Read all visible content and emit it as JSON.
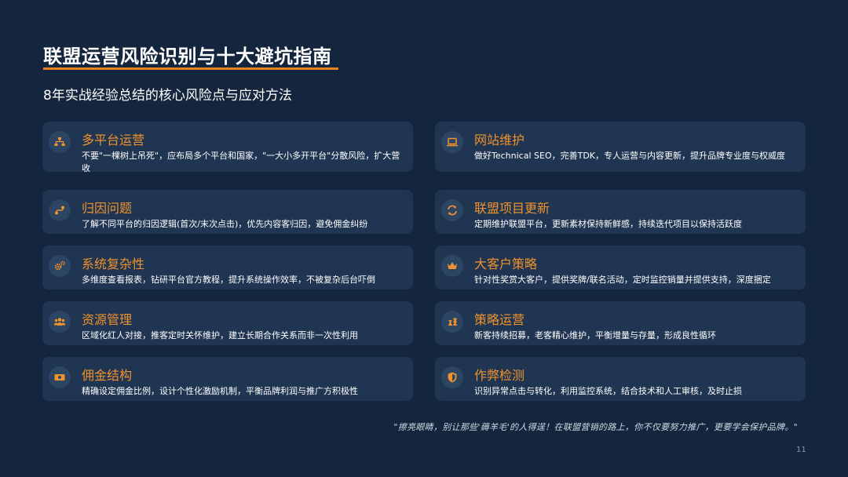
{
  "header": {
    "title": "联盟运营风险识别与十大避坑指南",
    "subtitle": "8年实战经验总结的核心风险点与应对方法"
  },
  "left_cards": [
    {
      "icon": "sitemap-icon",
      "title": "多平台运营",
      "desc": "不要\"一棵树上吊死\"，应布局多个平台和国家，\"一大小多开平台\"分散风险，扩大营收"
    },
    {
      "icon": "route-icon",
      "title": "归因问题",
      "desc": "了解不同平台的归因逻辑(首次/末次点击)，优先内容客归因，避免佣金纠纷"
    },
    {
      "icon": "gears-icon",
      "title": "系统复杂性",
      "desc": "多维度查看报表，钻研平台官方教程，提升系统操作效率，不被复杂后台吓倒"
    },
    {
      "icon": "users-icon",
      "title": "资源管理",
      "desc": "区域化红人对接，推客定时关怀维护，建立长期合作关系而非一次性利用"
    },
    {
      "icon": "money-icon",
      "title": "佣金结构",
      "desc": "精确设定佣金比例，设计个性化激励机制，平衡品牌利润与推广方积极性"
    }
  ],
  "right_cards": [
    {
      "icon": "laptop-icon",
      "title": "网站维护",
      "desc": "做好Technical SEO，完善TDK，专人运营与内容更新，提升品牌专业度与权威度"
    },
    {
      "icon": "sync-icon",
      "title": "联盟项目更新",
      "desc": "定期维护联盟平台，更新素材保持新鲜感，持续迭代项目以保持活跃度"
    },
    {
      "icon": "crown-icon",
      "title": "大客户策略",
      "desc": "针对性奖赏大客户，提供奖牌/联名活动，定时监控销量并提供支持，深度捆定"
    },
    {
      "icon": "chess-icon",
      "title": "策略运营",
      "desc": "新客持续招募，老客精心维护，平衡增量与存量，形成良性循环"
    },
    {
      "icon": "shield-icon",
      "title": "作弊检测",
      "desc": "识别异常点击与转化，利用监控系统，结合技术和人工审核，及时止损"
    }
  ],
  "footer": {
    "quote": "\"擦亮眼睛，别让那些'薅羊毛'的人得逞！在联盟营销的路上，你不仅要努力推广，更要学会保护品牌。\"",
    "page_number": "11"
  },
  "colors": {
    "background": "#14263d",
    "card": "#1f3551",
    "accent": "#f0922d",
    "underline": "#e8841f"
  }
}
